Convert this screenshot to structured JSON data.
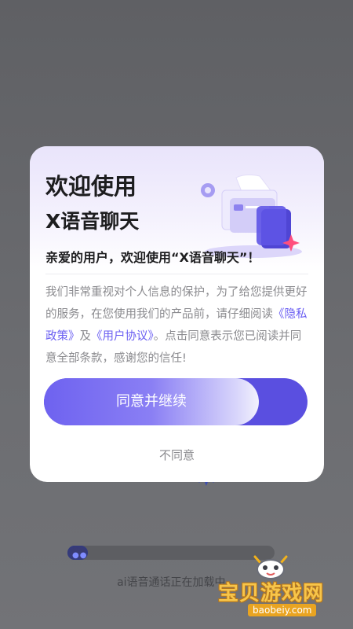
{
  "background": {
    "loading_text": "ai语音通话正在加载中...",
    "loading_progress_fraction": 0.1
  },
  "dialog": {
    "title_line1": "欢迎使用",
    "title_line2": "X语音聊天",
    "greeting": "亲爱的用户，欢迎使用“X语音聊天”！",
    "body_part1": "我们非常重视对个人信息的保护，为了给您提供更好的服务，在您使用我们的产品前，请仔细阅读",
    "privacy_link": "《隐私政策》",
    "and_text": "及",
    "terms_link": "《用户协议》",
    "body_part2": "。点击同意表示您已阅读并同意全部条款，感谢您的信任!",
    "agree_button": "同意并继续",
    "disagree_button": "不同意",
    "illustration_icon": "document-cards-illustration"
  },
  "watermark": {
    "title": "宝贝游戏网",
    "url": "baobeiy.com",
    "icon": "game-controller-mascot"
  },
  "colors": {
    "accent": "#6a5ef2",
    "button_start": "#6e62f0",
    "overlay": "#6b6c70"
  }
}
